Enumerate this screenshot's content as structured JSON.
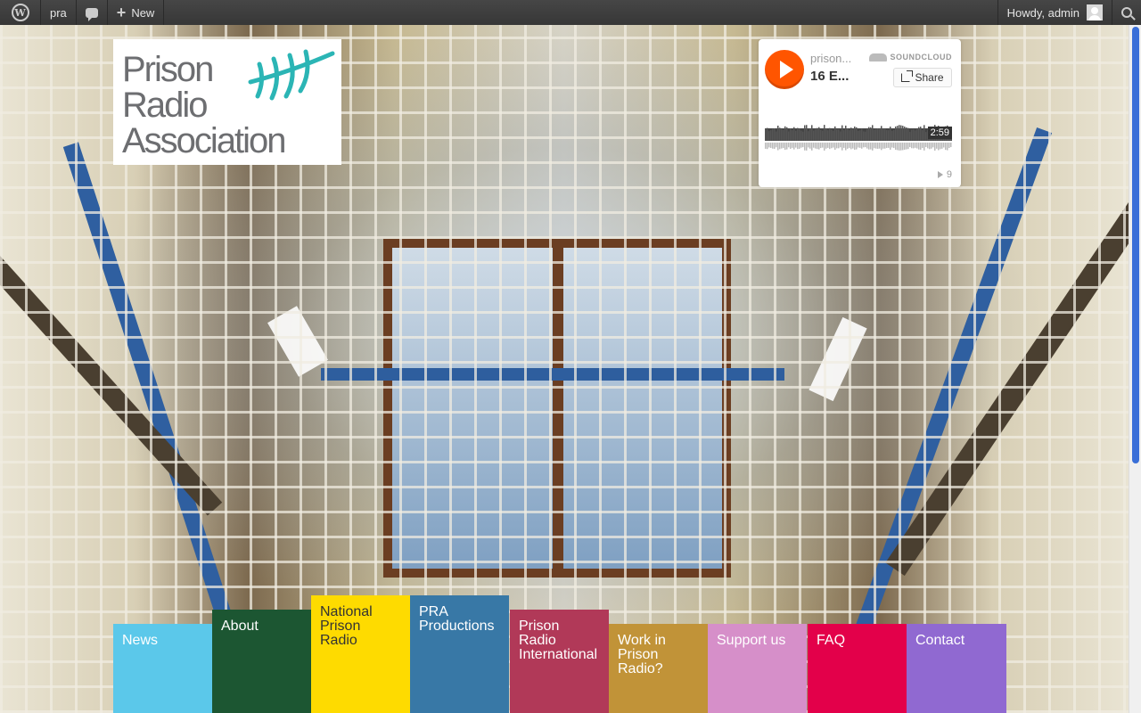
{
  "adminbar": {
    "site_name": "pra",
    "new_label": "New",
    "howdy": "Howdy, admin"
  },
  "logo": {
    "line1": "Prison",
    "line2": "Radio",
    "line3": "Association"
  },
  "soundcloud": {
    "user": "prison...",
    "title": "16 E...",
    "brand": "SOUNDCLOUD",
    "share_label": "Share",
    "duration": "2:59",
    "plays": "9"
  },
  "nav": [
    {
      "label": "News",
      "color": "#5bc8ea"
    },
    {
      "label": "About",
      "color": "#1c5632"
    },
    {
      "label": "National Prison Radio",
      "color": "#fedb00"
    },
    {
      "label": "PRA Productions",
      "color": "#3878a6"
    },
    {
      "label": "Prison Radio International",
      "color": "#b13958"
    },
    {
      "label": "Work in Prison Radio?",
      "color": "#c19338"
    },
    {
      "label": "Support us",
      "color": "#d68fc9"
    },
    {
      "label": "FAQ",
      "color": "#e3004a"
    },
    {
      "label": "Contact",
      "color": "#9069d1"
    }
  ]
}
